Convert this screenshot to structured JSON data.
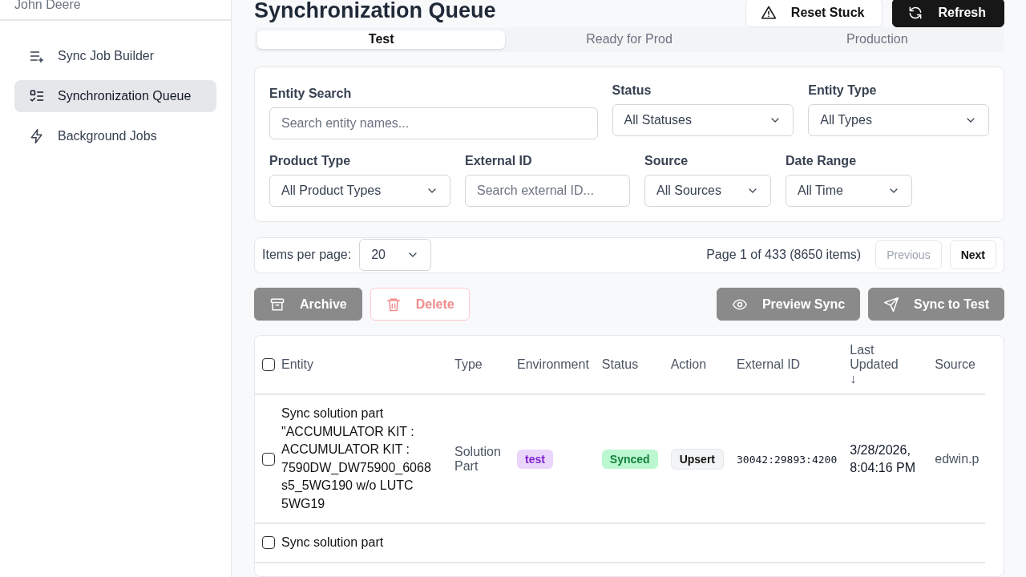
{
  "sidebar": {
    "org": "John Deere",
    "items": [
      {
        "label": "Sync Job Builder",
        "selected": false
      },
      {
        "label": "Synchronization Queue",
        "selected": true
      },
      {
        "label": "Background Jobs",
        "selected": false
      }
    ]
  },
  "page_title": "Synchronization Queue",
  "header_buttons": [
    {
      "label": "Reset Stuck",
      "kind": "outline"
    },
    {
      "label": "Refresh",
      "kind": "dark"
    }
  ],
  "tabs": [
    {
      "label": "Test",
      "selected": true
    },
    {
      "label": "Ready for Prod",
      "selected": false
    },
    {
      "label": "Production",
      "selected": false
    }
  ],
  "filters": [
    {
      "label": "Entity Search",
      "kind": "input",
      "placeholder": "Search entity names..."
    },
    {
      "label": "Status",
      "kind": "select",
      "value": "All Statuses"
    },
    {
      "label": "Entity Type",
      "kind": "select",
      "value": "All Types"
    },
    {
      "label": "Product Type",
      "kind": "select",
      "value": "All Product Types"
    },
    {
      "label": "External ID",
      "kind": "input",
      "placeholder": "Search external ID..."
    },
    {
      "label": "Source",
      "kind": "select",
      "value": "All Sources"
    },
    {
      "label": "Date Range",
      "kind": "select",
      "value": "All Time"
    }
  ],
  "pagination": {
    "per_page_label": "Items per page:",
    "per_page": "20",
    "info": "Page 1 of 433 (8650 items)",
    "previous": {
      "label": "Previous",
      "disabled": true
    },
    "next": {
      "label": "Next",
      "disabled": false
    }
  },
  "actions": [
    {
      "label": "Archive",
      "kind": "grey"
    },
    {
      "label": "Delete",
      "kind": "danger"
    },
    {
      "label": "Preview Sync",
      "kind": "grey"
    },
    {
      "label": "Sync to Test",
      "kind": "grey"
    }
  ],
  "table": {
    "select_all": {
      "checked": false
    },
    "columns": [
      "Entity",
      "Type",
      "Environment",
      "Status",
      "Action",
      "External ID",
      "Last Updated ↓",
      "Source"
    ],
    "rows": [
      {
        "checked": false,
        "entity": "Sync solution part \"ACCUMULATOR KIT : ACCUMULATOR KIT : 7590DW_DW75900_6068 s5_5WG190 w/o LUTC 5WG19",
        "type": "Solution Part",
        "environment": "test",
        "status": "Synced",
        "action": "Upsert",
        "external_id": "30042:29893:4200",
        "updated": "3/28/2026, 8:04:16 PM",
        "source": "edwin.p"
      },
      {
        "checked": false,
        "entity": "Sync solution part"
      }
    ]
  }
}
